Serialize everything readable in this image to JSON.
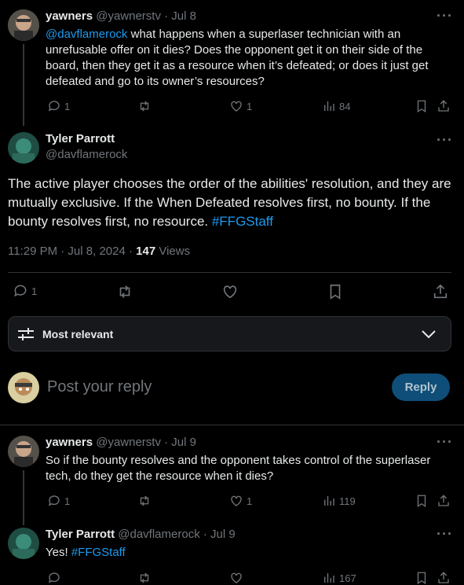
{
  "tweet1": {
    "name": "yawners",
    "handle": "@yawnerstv",
    "date": "· Jul 8",
    "mention": "@davflamerock",
    "text": " what happens when a superlaser technician with an unrefusable offer on it dies? Does the opponent get it on their side of the board, then they get it as a resource when it’s defeated; or does it just get defeated and go to its owner’s resources?",
    "replies": "1",
    "likes": "1",
    "views": "84"
  },
  "main_tweet": {
    "name": "Tyler Parrott",
    "handle": "@davflamerock",
    "text": "The active player chooses the order of the abilities' resolution, and they are mutually exclusive. If the When Defeated resolves first, no bounty. If the bounty resolves first, no resource. ",
    "hashtag": "#FFGStaff",
    "timestamp": "11:29 PM · Jul 8, 2024 · ",
    "views_count": "147",
    "views_label": " Views",
    "replies": "1"
  },
  "sort": {
    "label": "Most relevant"
  },
  "compose": {
    "placeholder": "Post your reply",
    "button": "Reply"
  },
  "reply1": {
    "name": "yawners",
    "handle": "@yawnerstv",
    "date": "· Jul 9",
    "text": "So if the bounty resolves and the opponent  takes control of the superlaser tech, do they get the resource when it dies?",
    "replies": "1",
    "likes": "1",
    "views": "119"
  },
  "reply2": {
    "name": "Tyler Parrott",
    "handle": "@davflamerock",
    "date": "· Jul 9",
    "text": "Yes! ",
    "hashtag": "#FFGStaff",
    "views": "167"
  },
  "more_glyph": "···",
  "colors": {
    "link": "#1d9bf0",
    "reply_button": "#1d9bf0",
    "muted": "#71767b"
  }
}
